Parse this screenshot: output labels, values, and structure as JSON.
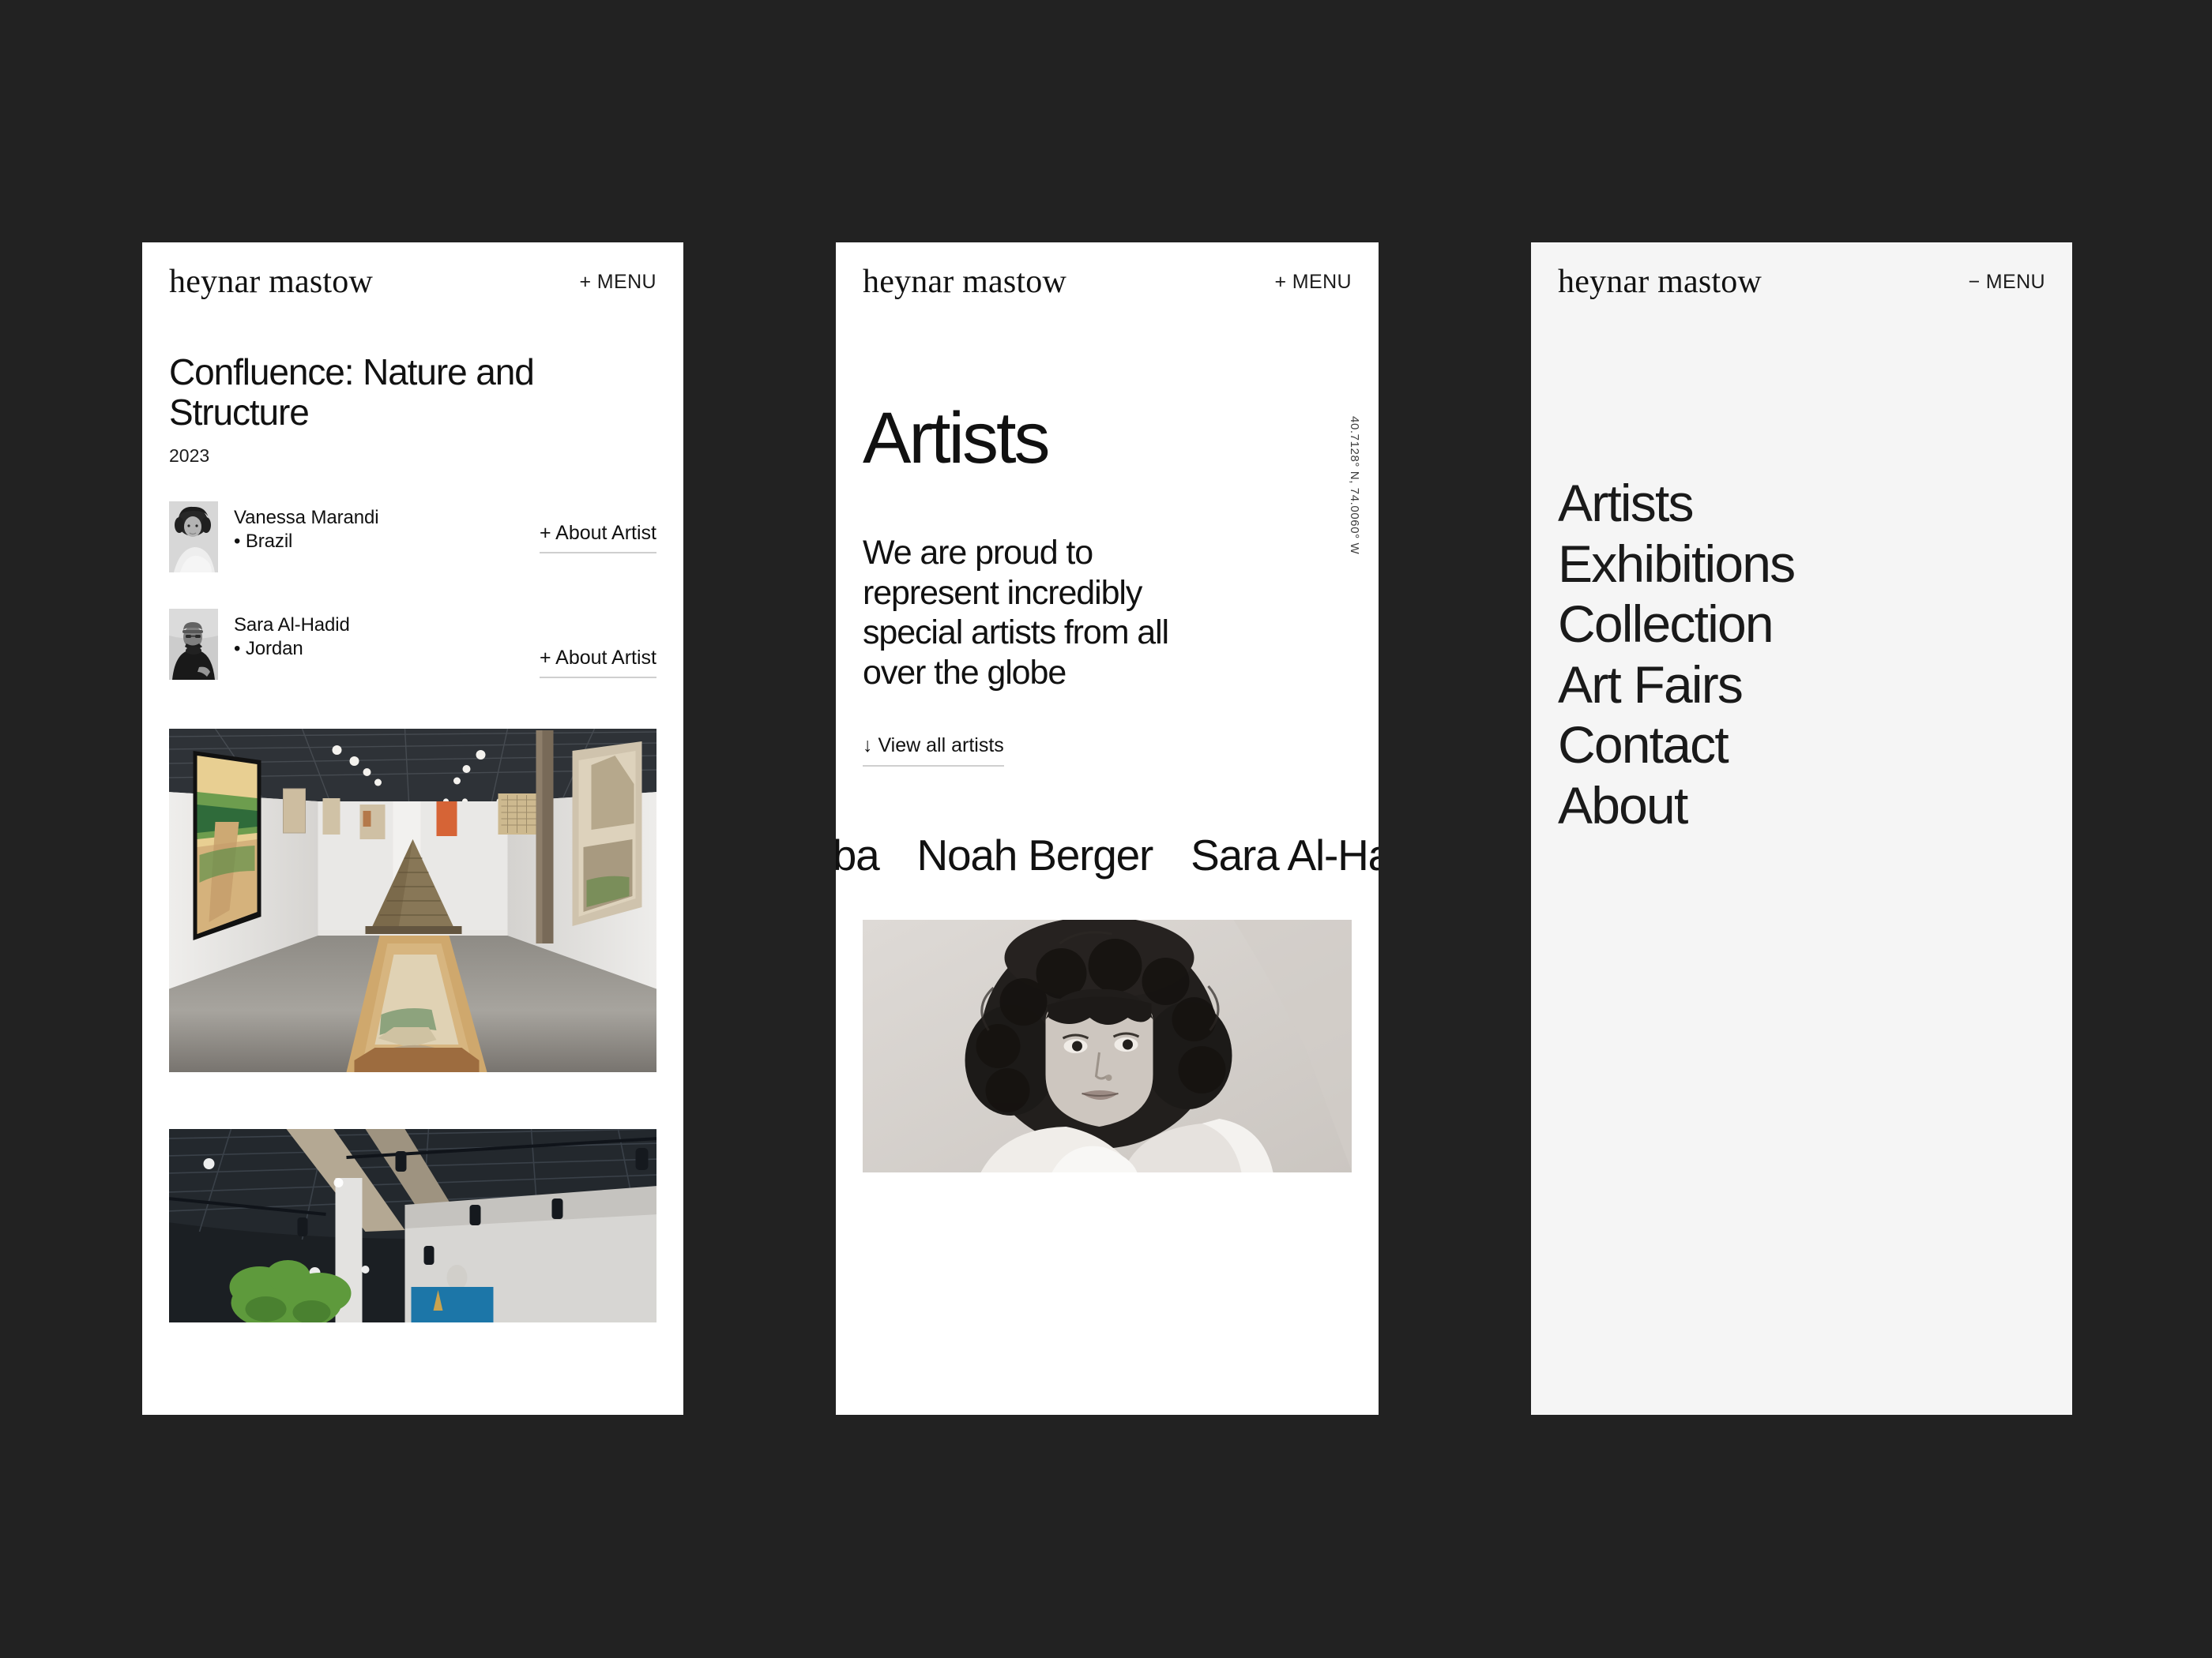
{
  "theme": {
    "page_background": "#222222",
    "panel_background": "#ffffff",
    "panel_background_alt": "#f5f5f5",
    "text_primary": "#111111",
    "rule_color": "#cfcfcf"
  },
  "brand": {
    "wordmark": "heynar mastow"
  },
  "panels": [
    {
      "id": "exhibition-detail",
      "header": {
        "wordmark": "heynar mastow",
        "menu_label": "+ MENU",
        "menu_icon": "plus-icon"
      },
      "exhibition": {
        "title": "Confluence: Nature and Structure",
        "year": "2023"
      },
      "artists": [
        {
          "name": "Vanessa Marandi",
          "country": "• Brazil",
          "about_label": "+ About Artist",
          "avatar_alt": "portrait-of-vanessa-marandi"
        },
        {
          "name": "Sara Al-Hadid",
          "country": "• Jordan",
          "about_label": "+ About Artist",
          "avatar_alt": "portrait-of-sara-al-hadid"
        }
      ],
      "images": [
        {
          "alt": "gallery-interior-with-pyramid-sculpture"
        },
        {
          "alt": "gallery-ceiling-with-track-lighting-and-plant"
        }
      ]
    },
    {
      "id": "artists-landing",
      "header": {
        "wordmark": "heynar mastow",
        "menu_label": "+ MENU",
        "menu_icon": "plus-icon"
      },
      "heading": "Artists",
      "coordinates": "40.7128° N, 74.0060° W",
      "lede": "We are proud to represent incredibly special artists from all over the globe",
      "cta": {
        "label": "View all artists",
        "arrow": "↓"
      },
      "marquee": {
        "clipped_start": "koba",
        "names": [
          "Noah Berger",
          "Sara Al-Ha"
        ]
      },
      "portrait": {
        "alt": "black-and-white-portrait-of-artist"
      }
    },
    {
      "id": "nav-overlay",
      "header": {
        "wordmark": "heynar mastow",
        "menu_label": "− MENU",
        "menu_icon": "minus-icon"
      },
      "nav_items": [
        "Artists",
        "Exhibitions",
        "Collection",
        "Art Fairs",
        "Contact",
        "About"
      ]
    }
  ]
}
